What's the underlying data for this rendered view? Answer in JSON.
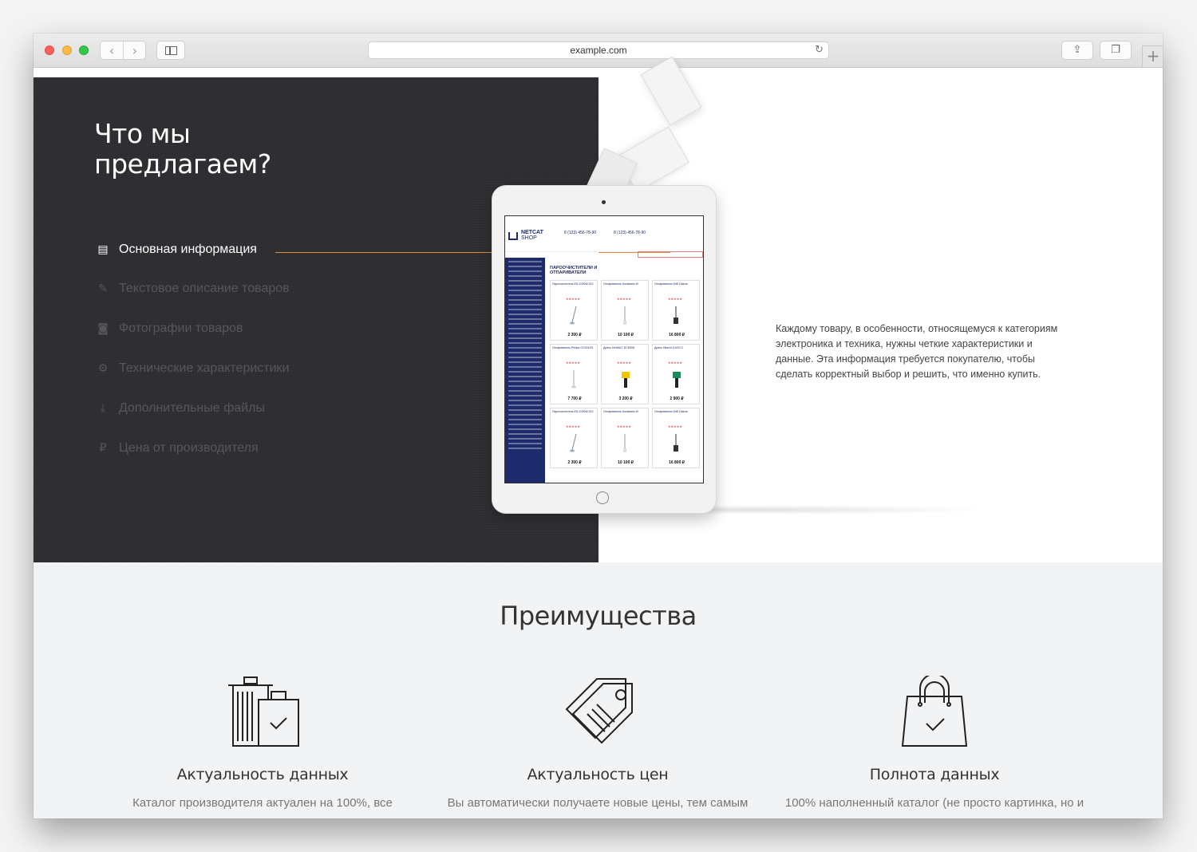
{
  "browser": {
    "url": "example.com",
    "back_icon": "‹",
    "forward_icon": "›",
    "reload_icon": "↻",
    "share_icon": "⇪",
    "tabs_icon": "❐",
    "new_tab_icon": "+"
  },
  "hero": {
    "title_line1": "Что мы",
    "title_line2": "предлагаем?",
    "menu": [
      {
        "icon": "document-icon",
        "glyph": "▤",
        "label": "Основная информация",
        "active": true
      },
      {
        "icon": "pencil-icon",
        "glyph": "✎",
        "label": "Текстовое описание товаров",
        "active": false
      },
      {
        "icon": "camera-icon",
        "glyph": "◙",
        "label": "Фотографии товаров",
        "active": false
      },
      {
        "icon": "gear-icon",
        "glyph": "⚙",
        "label": "Технические характеристики",
        "active": false
      },
      {
        "icon": "download-icon",
        "glyph": "⤓",
        "label": "Дополнительные файлы",
        "active": false
      },
      {
        "icon": "ruble-icon",
        "glyph": "₽",
        "label": "Цена от производителя",
        "active": false
      }
    ],
    "description": "Каждому товару, в особенности, относящемуся к категориям электроника и техника, нужны четкие характеристики и данные. Эта информация требуется покупателю, чтобы сделать корректный выбор и решить, что именно купить.",
    "tablet": {
      "brand_line1": "NETCAT",
      "brand_line2": "SHOP",
      "phone1": "8 (123) 456-78-90",
      "phone2": "8 (123) 456-78-90",
      "heading": "ПАРООЧИСТИТЕЛИ И ОТПАРИВАТЕЛИ",
      "stars": "★★★★★",
      "products": [
        {
          "name": "Пароочиститель EN-1000W-012",
          "price": "2 300 ₽"
        },
        {
          "name": "Отпариватель Assistants M",
          "price": "10 100 ₽"
        },
        {
          "name": "Отпариватель MIE Deluxe",
          "price": "16 800 ₽"
        },
        {
          "name": "Отпариватель Philips GC524/20",
          "price": "7 700 ₽"
        },
        {
          "name": "Дрель DeWALT DCD908",
          "price": "3 200 ₽"
        },
        {
          "name": "Дрель Hitachi D10VC2",
          "price": "2 900 ₽"
        },
        {
          "name": "Пароочиститель EN-1000W-012",
          "price": "2 300 ₽"
        },
        {
          "name": "Отпариватель Assistants M",
          "price": "10 100 ₽"
        },
        {
          "name": "Отпариватель MIE Deluxe",
          "price": "16 800 ₽"
        }
      ]
    }
  },
  "advantages": {
    "title": "Преимущества",
    "items": [
      {
        "icon": "trash-check-icon",
        "title": "Актуальность данных",
        "text": "Каталог производителя актуален на 100%, все"
      },
      {
        "icon": "price-tags-icon",
        "title": "Актуальность цен",
        "text": "Вы автоматически получаете новые цены, тем самым"
      },
      {
        "icon": "shopping-bag-icon",
        "title": "Полнота данных",
        "text": "100% наполненный каталог (не просто картинка, но и"
      }
    ]
  },
  "colors": {
    "dark_panel": "#2c2d30",
    "accent_line": "#e08a3a",
    "tablet_sidebar": "#1d2a6b",
    "advantages_bg": "#f2f3f5"
  }
}
